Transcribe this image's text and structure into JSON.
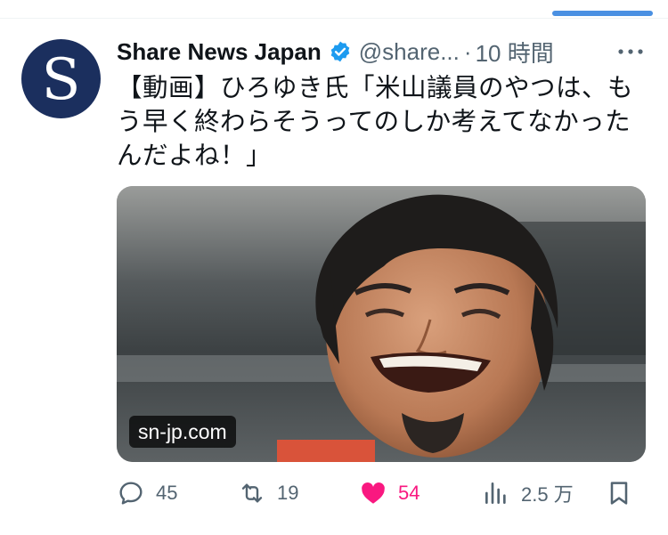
{
  "account": {
    "avatar_letter": "S",
    "display_name": "Share News Japan",
    "handle": "@share...",
    "time_separator": "·",
    "time": "10 時間"
  },
  "tweet": {
    "text": "【動画】ひろゆき氏「米山議員のやつは、もう早く終わらそうってのしか考えてなかったんだよね！」",
    "link_domain": "sn-jp.com"
  },
  "actions": {
    "replies": "45",
    "retweets": "19",
    "likes": "54",
    "views": "2.5 万"
  },
  "colors": {
    "accent": "#4a90e2",
    "like": "#f91880",
    "verified": "#1d9bf0",
    "avatar_bg": "#1b2f5e",
    "muted": "#536471"
  },
  "icons": [
    "verified-badge-icon",
    "more-icon",
    "reply-icon",
    "retweet-icon",
    "like-icon",
    "views-icon",
    "bookmark-icon"
  ]
}
